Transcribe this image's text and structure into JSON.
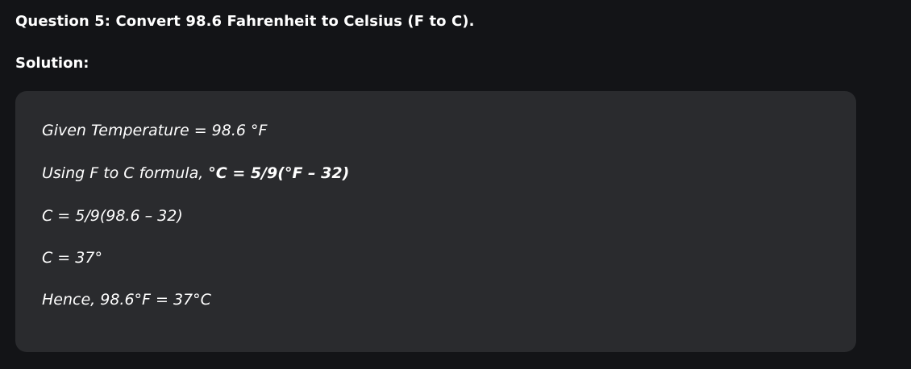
{
  "question": {
    "text": "Question 5: Convert 98.6 Fahrenheit to Celsius (F to C)."
  },
  "solution": {
    "label": "Solution:",
    "lines": [
      {
        "text": "Given Temperature = 98.6 °F"
      },
      {
        "prefix": "Using F to C formula, ",
        "bold": "°C = 5/9(°F – 32)"
      },
      {
        "text": "C = 5/9(98.6 – 32)"
      },
      {
        "text": "C = 37°"
      },
      {
        "text": "Hence, 98.6°F = 37°C"
      }
    ]
  }
}
